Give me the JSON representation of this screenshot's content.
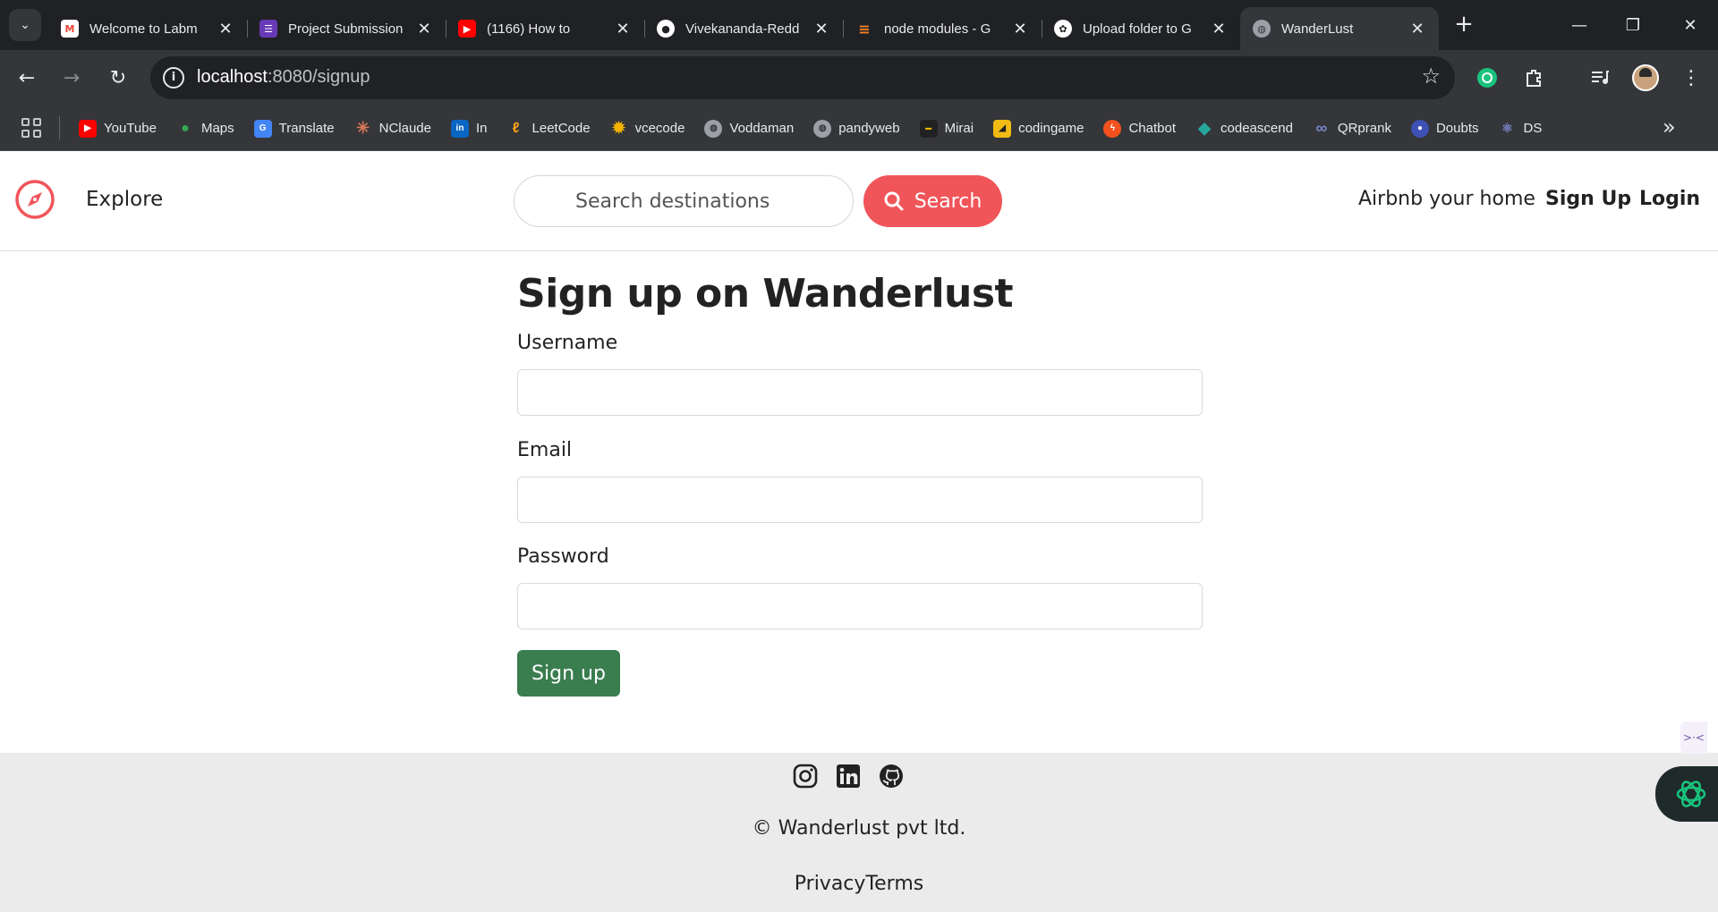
{
  "browser": {
    "tabs": [
      {
        "title": "Welcome to Labm",
        "favicon": "gmail-icon",
        "color": "#ea4335"
      },
      {
        "title": "Project Submission",
        "favicon": "forms-icon",
        "color": "#673ab7"
      },
      {
        "title": "(1166) How to",
        "favicon": "youtube-icon",
        "color": "#ff0000"
      },
      {
        "title": "Vivekananda-Redd",
        "favicon": "github-icon",
        "color": "#ffffff"
      },
      {
        "title": "node modules - G",
        "favicon": "stackoverflow-icon",
        "color": "#f48024"
      },
      {
        "title": "Upload folder to G",
        "favicon": "chatgpt-icon",
        "color": "#ffffff"
      },
      {
        "title": "WanderLust",
        "favicon": "globe-icon",
        "color": "#9aa0a6",
        "active": true
      }
    ],
    "url_host": "localhost",
    "url_path": ":8080/signup",
    "bookmarks": [
      {
        "label": "YouTube",
        "icon": "youtube-icon",
        "color": "#ff0000"
      },
      {
        "label": "Maps",
        "icon": "maps-icon",
        "color": "#34a853"
      },
      {
        "label": "Translate",
        "icon": "translate-icon",
        "color": "#4285f4"
      },
      {
        "label": "NClaude",
        "icon": "claude-icon",
        "color": "#d97757"
      },
      {
        "label": "In",
        "icon": "linkedin-icon",
        "color": "#0a66c2"
      },
      {
        "label": "LeetCode",
        "icon": "leetcode-icon",
        "color": "#ffa116"
      },
      {
        "label": "vcecode",
        "icon": "vcecode-icon",
        "color": "#f4b400"
      },
      {
        "label": "Voddaman",
        "icon": "globe-icon",
        "color": "#9aa0a6"
      },
      {
        "label": "pandyweb",
        "icon": "globe-icon",
        "color": "#9aa0a6"
      },
      {
        "label": "Mirai",
        "icon": "mirai-icon",
        "color": "#222222"
      },
      {
        "label": "codingame",
        "icon": "codingame-icon",
        "color": "#f2bb13"
      },
      {
        "label": "Chatbot",
        "icon": "chatbot-icon",
        "color": "#f4511e"
      },
      {
        "label": "codeascend",
        "icon": "codeascend-icon",
        "color": "#26a69a"
      },
      {
        "label": "QRprank",
        "icon": "infinity-icon",
        "color": "#5c6bc0"
      },
      {
        "label": "Doubts",
        "icon": "doubts-icon",
        "color": "#3f51b5"
      },
      {
        "label": "DS",
        "icon": "ds-icon",
        "color": "#5c6bc0"
      }
    ]
  },
  "site": {
    "brand_icon": "compass-icon",
    "brand_color": "#f0555a",
    "explore": "Explore",
    "search_placeholder": "Search destinations",
    "search_button": "Search",
    "nav": {
      "host": "Airbnb your home",
      "signup": "Sign Up",
      "login": "Login"
    }
  },
  "form": {
    "title": "Sign up on Wanderlust",
    "username_label": "Username",
    "username_value": "",
    "email_label": "Email",
    "email_value": "",
    "password_label": "Password",
    "password_value": "",
    "submit": "Sign up",
    "submit_color": "#3a7d4f"
  },
  "footer": {
    "socials": [
      "instagram-icon",
      "linkedin-icon",
      "github-icon"
    ],
    "copyright": "© Wanderlust pvt ltd.",
    "links": [
      "Privacy",
      "Terms"
    ]
  }
}
